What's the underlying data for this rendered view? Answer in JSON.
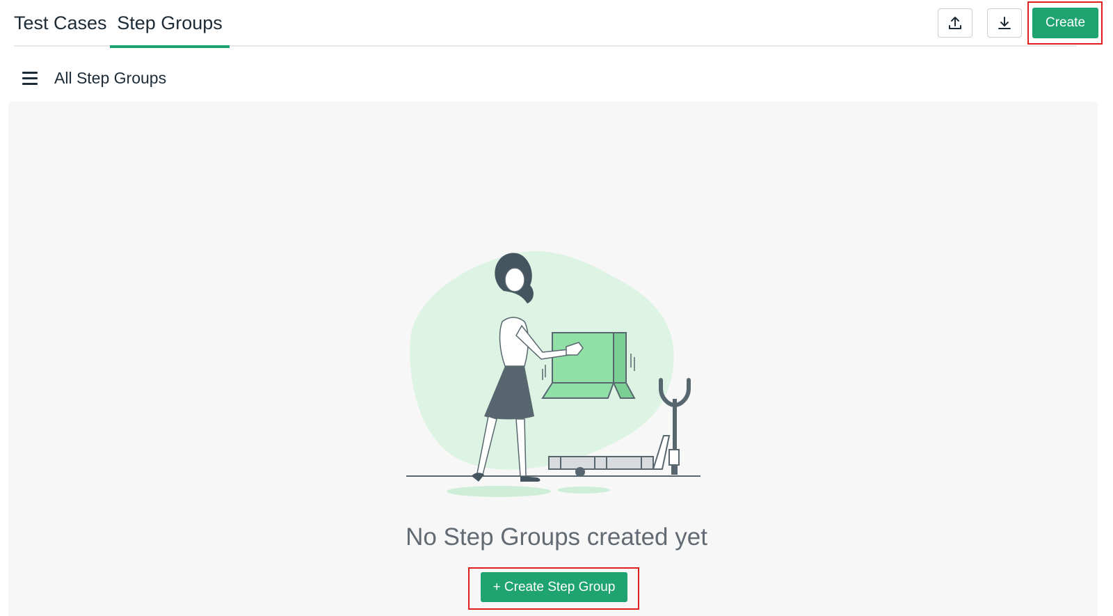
{
  "tabs": [
    {
      "label": "Test Cases",
      "active": false
    },
    {
      "label": "Step Groups",
      "active": true
    }
  ],
  "toolbar": {
    "upload_icon": "upload-icon",
    "download_icon": "download-icon",
    "create_label": "Create"
  },
  "subheader": {
    "menu_icon": "hamburger-menu-icon",
    "title": "All Step Groups"
  },
  "empty_state": {
    "illustration": "woman-carrying-box-illustration",
    "message": "No Step Groups created yet",
    "cta_label": "+ Create Step Group"
  },
  "colors": {
    "accent": "#1fa370",
    "highlight": "#e11d1d",
    "text": "#1d2b36",
    "muted_text": "#626a73",
    "panel_bg": "#f7f7f7"
  }
}
